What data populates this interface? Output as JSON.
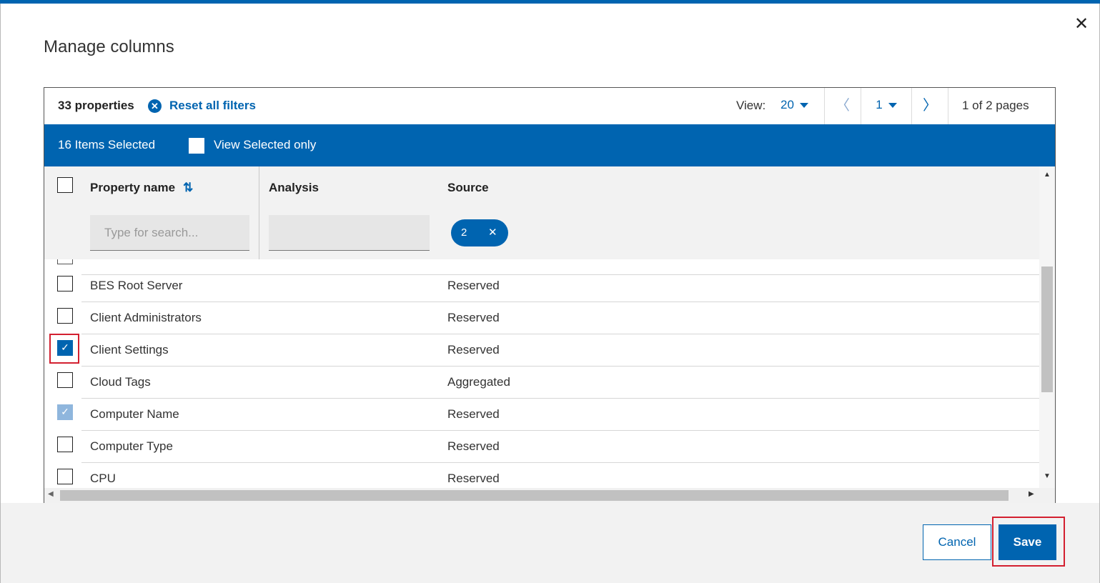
{
  "dialog": {
    "title": "Manage columns",
    "close_glyph": "✕"
  },
  "toolbar": {
    "properties_count": "33 properties",
    "reset_label": "Reset all filters",
    "reset_glyph": "✕",
    "view_label": "View:",
    "view_value": "20",
    "prev_glyph": "〈",
    "page_value": "1",
    "next_glyph": "〉",
    "page_info": "1 of 2 pages"
  },
  "selection_bar": {
    "selected_count": "16 Items Selected",
    "view_selected_label": "View Selected only",
    "view_selected_checked": false
  },
  "table": {
    "headers": {
      "property_name": "Property name",
      "sort_glyph": "⇅",
      "analysis": "Analysis",
      "source": "Source"
    },
    "search_placeholder": "Type for search...",
    "source_filter_chip": {
      "value": "2",
      "remove_glyph": "✕"
    },
    "rows": [
      {
        "name": "BES Root Server",
        "source": "Reserved",
        "state": "unchecked"
      },
      {
        "name": "Client Administrators",
        "source": "Reserved",
        "state": "unchecked"
      },
      {
        "name": "Client Settings",
        "source": "Reserved",
        "state": "checked"
      },
      {
        "name": "Cloud Tags",
        "source": "Aggregated",
        "state": "unchecked"
      },
      {
        "name": "Computer Name",
        "source": "Reserved",
        "state": "checked-disabled"
      },
      {
        "name": "Computer Type",
        "source": "Reserved",
        "state": "unchecked"
      },
      {
        "name": "CPU",
        "source": "Reserved",
        "state": "unchecked"
      }
    ],
    "check_glyph": "✓"
  },
  "scrollbars": {
    "up_glyph": "▲",
    "down_glyph": "▼",
    "left_glyph": "◀",
    "right_glyph": "▶"
  },
  "footer": {
    "cancel_label": "Cancel",
    "save_label": "Save"
  },
  "colors": {
    "accent": "#0064b0",
    "highlight": "#d32030"
  }
}
